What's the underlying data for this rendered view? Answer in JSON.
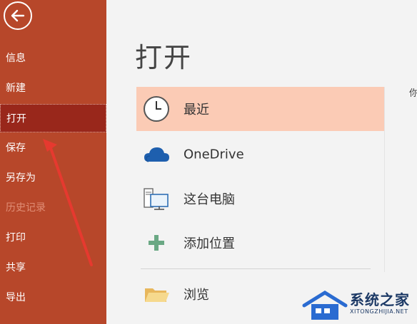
{
  "sidebar": {
    "items": [
      {
        "label": "信息"
      },
      {
        "label": "新建"
      },
      {
        "label": "打开"
      },
      {
        "label": "保存"
      },
      {
        "label": "另存为"
      },
      {
        "label": "历史记录"
      },
      {
        "label": "打印"
      },
      {
        "label": "共享"
      },
      {
        "label": "导出"
      }
    ],
    "selected": "打开",
    "disabled": [
      "历史记录"
    ]
  },
  "main": {
    "title": "打开",
    "locations": [
      {
        "label": "最近",
        "icon": "clock-icon"
      },
      {
        "label": "OneDrive",
        "icon": "cloud-icon"
      },
      {
        "label": "这台电脑",
        "icon": "computer-icon"
      },
      {
        "label": "添加位置",
        "icon": "plus-icon"
      },
      {
        "label": "浏览",
        "icon": "folder-icon"
      }
    ],
    "selected": "最近",
    "cut_text": "你"
  },
  "watermark": {
    "title": "系统之家",
    "url": "XITONGZHIJIA.NET"
  },
  "colors": {
    "sidebar": "#b7472a",
    "sidebar_selected": "#99271b",
    "location_selected": "#fbcbb5",
    "arrow": "#e6392f"
  }
}
